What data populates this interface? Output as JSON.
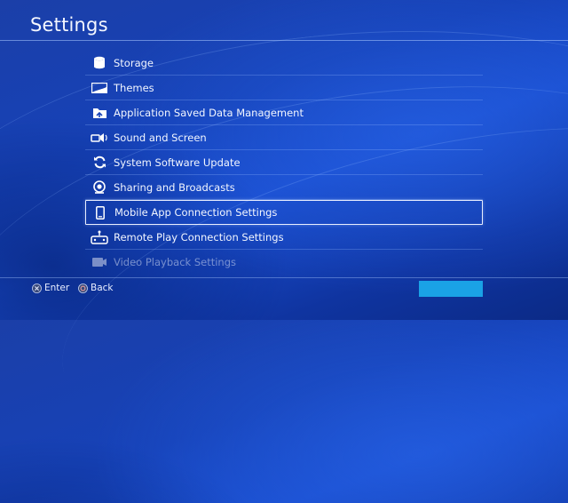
{
  "page": {
    "title": "Settings"
  },
  "menu": {
    "items": [
      {
        "label": "Storage",
        "icon": "storage-icon"
      },
      {
        "label": "Themes",
        "icon": "themes-icon"
      },
      {
        "label": "Application Saved Data Management",
        "icon": "saved-data-icon"
      },
      {
        "label": "Sound and Screen",
        "icon": "sound-screen-icon"
      },
      {
        "label": "System Software Update",
        "icon": "update-icon"
      },
      {
        "label": "Sharing and Broadcasts",
        "icon": "sharing-icon"
      },
      {
        "label": "Mobile App Connection Settings",
        "icon": "mobile-icon",
        "selected": true
      },
      {
        "label": "Remote Play Connection Settings",
        "icon": "remote-play-icon"
      },
      {
        "label": "Video Playback Settings",
        "icon": "video-playback-icon"
      }
    ]
  },
  "footer": {
    "enter_label": "Enter",
    "back_label": "Back"
  },
  "colors": {
    "background": "#1642b8",
    "accent": "#1aa2e6",
    "text": "#ffffff"
  }
}
